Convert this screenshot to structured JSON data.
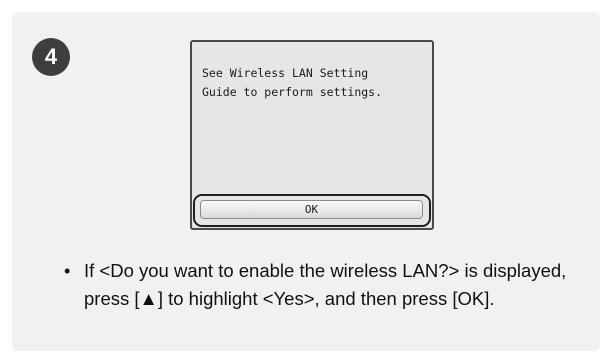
{
  "step": {
    "number": "4"
  },
  "screen": {
    "message": "See Wireless LAN Setting\nGuide to perform settings.",
    "ok_label": "OK"
  },
  "instruction": {
    "bullet": "•",
    "text": "If <Do you want to enable the wireless LAN?> is displayed, press [▲] to highlight <Yes>, and then press [OK]."
  },
  "colors": {
    "panel_background": "#f1f1f1",
    "badge_background": "#3e3e3e",
    "screen_background": "#e6e6e6"
  }
}
